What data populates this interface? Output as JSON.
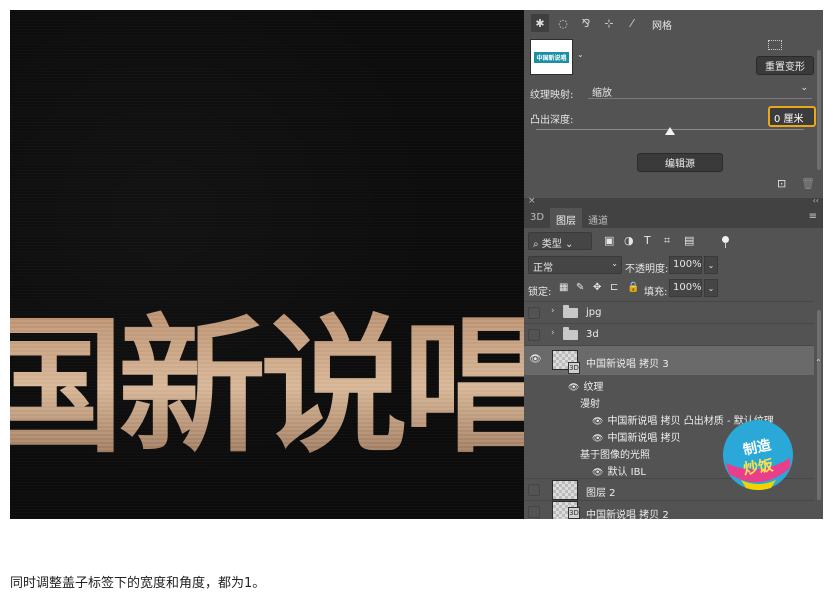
{
  "canvas": {
    "artwork_text": "国新说唱"
  },
  "properties": {
    "mesh_label": "网格",
    "thumb_label": "中国新说唱",
    "reset_button": "重置变形",
    "texture_label": "纹理映射:",
    "texture_value": "缩放",
    "depth_label": "凸出深度:",
    "depth_value": "0 厘米",
    "edit_source_button": "编辑源"
  },
  "layers_panel": {
    "tabs": [
      "3D",
      "图层",
      "通道"
    ],
    "active_tab": "图层",
    "filter_select": "类型",
    "filter_icons": [
      "image-filter-icon",
      "adjustment-filter-icon",
      "type-filter-icon",
      "shape-filter-icon",
      "smart-object-filter-icon"
    ],
    "blend_mode": "正常",
    "opacity_label": "不透明度:",
    "opacity_value": "100%",
    "lock_label": "锁定:",
    "fill_label": "填充:",
    "fill_value": "100%",
    "layers": [
      {
        "name": "jpg",
        "type": "group"
      },
      {
        "name": "3d",
        "type": "group"
      },
      {
        "name": "中国新说唱 拷贝 3",
        "type": "3d",
        "visible": true,
        "selected": true
      },
      {
        "name": "图层 2",
        "type": "layer"
      },
      {
        "name": "中国新说唱 拷贝 2",
        "type": "3d"
      }
    ],
    "sublayers": {
      "texture": "纹理",
      "diffuse": "漫射",
      "material": "中国新说唱 拷贝 凸出材质 - 默认纹理",
      "copy": "中国新说唱 拷贝",
      "ibl_group": "基于图像的光照",
      "ibl_default": "默认 IBL",
      "cut_off": "纹理"
    }
  },
  "watermark_text": "制造炒饭",
  "caption": "同时调整盖子标签下的宽度和角度，都为1。",
  "colors": {
    "panel_bg": "#535353",
    "highlight": "#e8a81a",
    "gold_text": "#c9a07c"
  }
}
